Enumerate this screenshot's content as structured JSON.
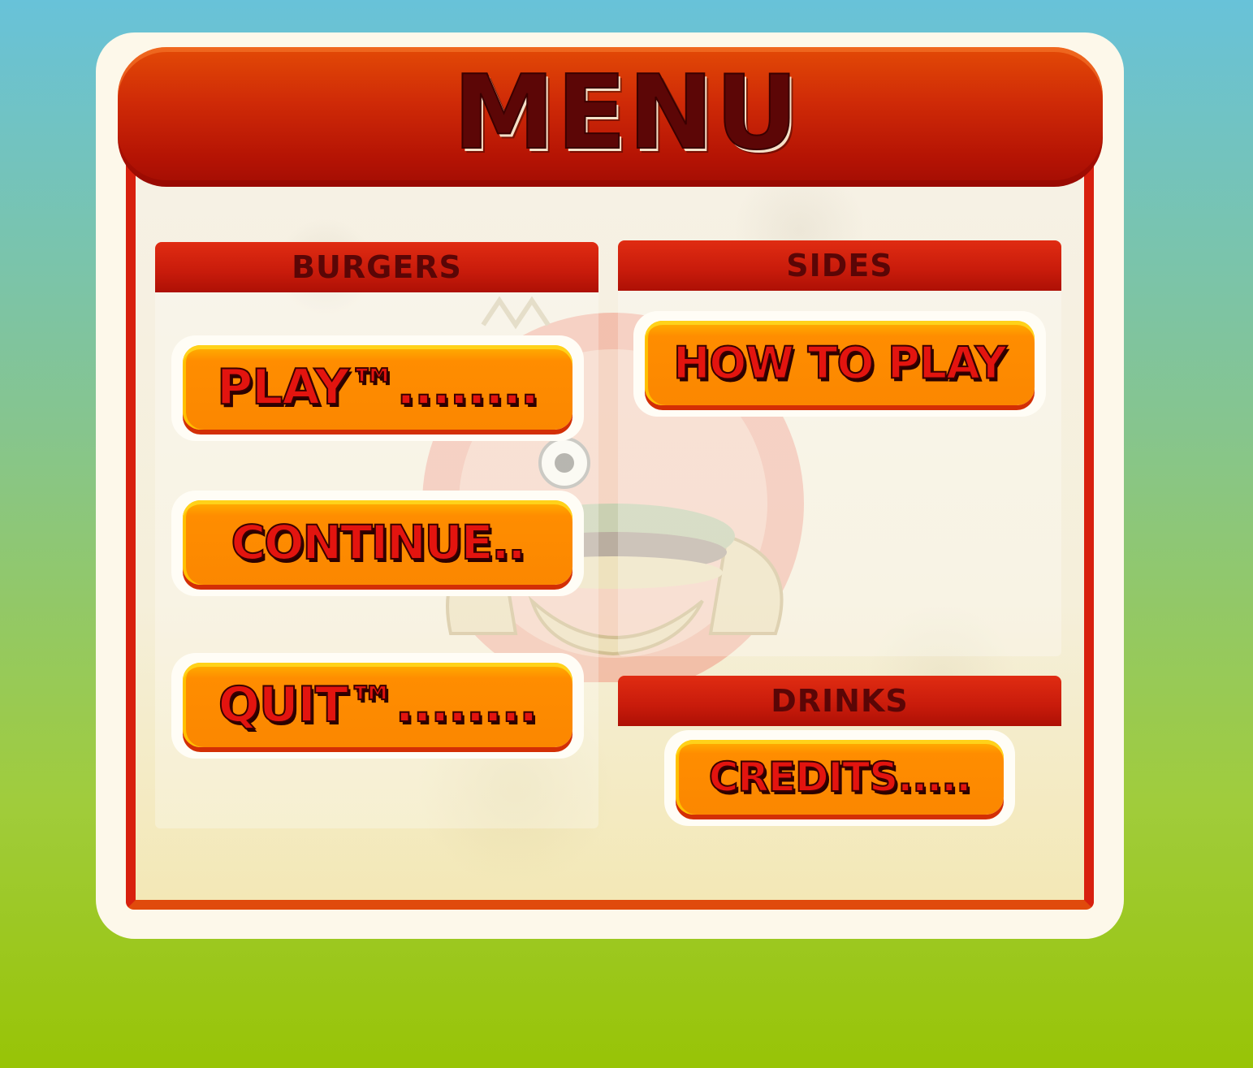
{
  "menu": {
    "title": "MENU"
  },
  "sections": {
    "burgers": {
      "header": "BURGERS",
      "buttons": {
        "play": "PLAY™........",
        "continue": "CONTINUE..",
        "quit": "QUIT™........"
      }
    },
    "sides": {
      "header": "SIDES",
      "buttons": {
        "how_to_play": "HOW TO PLAY"
      }
    },
    "drinks": {
      "header": "DRINKS",
      "buttons": {
        "credits": "CREDITS....."
      }
    }
  },
  "colors": {
    "banner": "#c41e08",
    "button": "#ff8d00",
    "button_text": "#e3140f",
    "header_text": "#5a0606"
  }
}
